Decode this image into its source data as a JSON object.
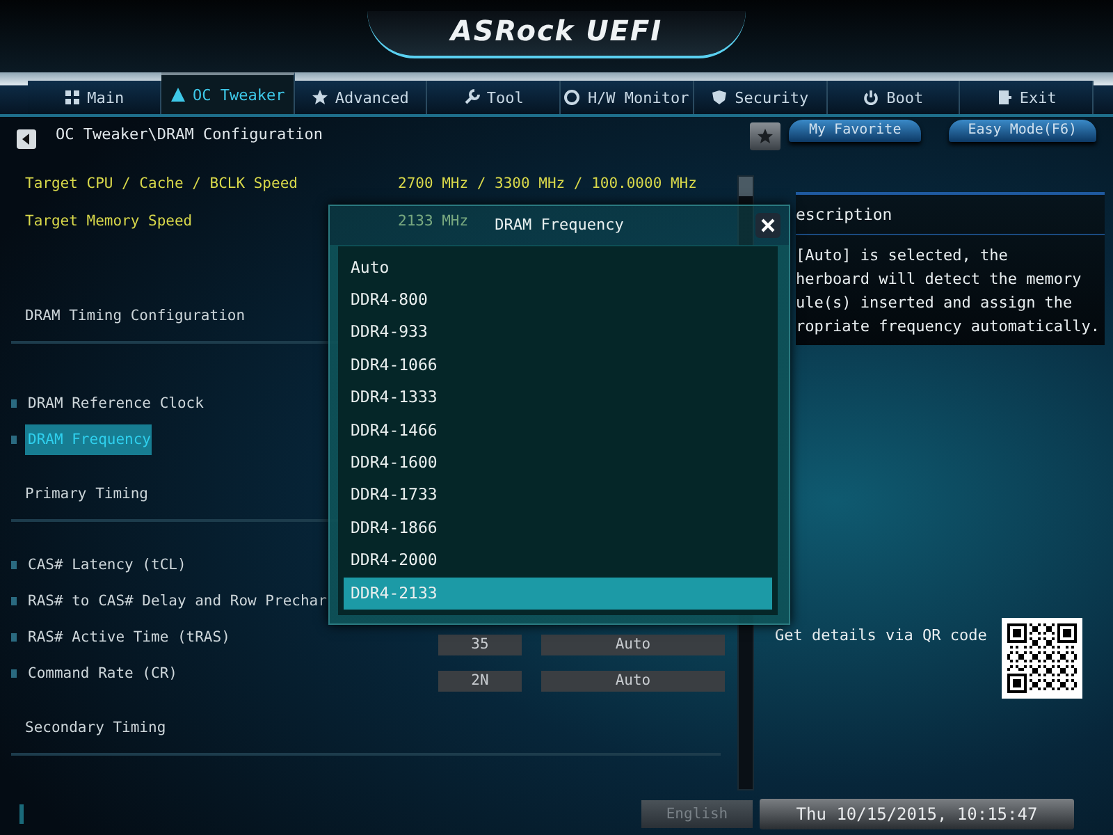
{
  "header": {
    "logo": "ASRock UEFI"
  },
  "tabs": [
    {
      "label": "Main",
      "selected": false
    },
    {
      "label": "OC Tweaker",
      "selected": true
    },
    {
      "label": "Advanced",
      "selected": false
    },
    {
      "label": "Tool",
      "selected": false
    },
    {
      "label": "H/W Monitor",
      "selected": false
    },
    {
      "label": "Security",
      "selected": false
    },
    {
      "label": "Boot",
      "selected": false
    },
    {
      "label": "Exit",
      "selected": false
    }
  ],
  "breadcrumb": {
    "path": "OC Tweaker\\DRAM Configuration"
  },
  "favorite_button": {
    "label": "My Favorite"
  },
  "easy_mode_button": {
    "label": "Easy Mode(F6)"
  },
  "settings": [
    {
      "kind": "info",
      "label": "Target CPU / Cache / BCLK Speed",
      "value": "2700 MHz / 3300 MHz / 100.0000 MHz"
    },
    {
      "kind": "info",
      "label": "Target Memory Speed",
      "value": "2133 MHz"
    },
    {
      "kind": "section",
      "label": "DRAM Timing Configuration"
    },
    {
      "kind": "setting",
      "label": "DRAM Reference Clock",
      "selected": false
    },
    {
      "kind": "setting",
      "label": "DRAM Frequency",
      "selected": true
    },
    {
      "kind": "section",
      "label": "Primary Timing"
    },
    {
      "kind": "setting",
      "label": "CAS# Latency (tCL)",
      "selected": false
    },
    {
      "kind": "setting",
      "label": "RAS# to CAS# Delay and Row Prechar",
      "selected": false
    },
    {
      "kind": "setting",
      "label": "RAS# Active Time (tRAS)",
      "selected": false,
      "value": "35",
      "option": "Auto"
    },
    {
      "kind": "setting",
      "label": "Command Rate (CR)",
      "selected": false,
      "value": "2N",
      "option": "Auto"
    },
    {
      "kind": "section",
      "label": "Secondary Timing"
    }
  ],
  "dialog": {
    "title": "DRAM Frequency",
    "options": [
      {
        "label": "Auto",
        "selected": false
      },
      {
        "label": "DDR4-800",
        "selected": false
      },
      {
        "label": "DDR4-933",
        "selected": false
      },
      {
        "label": "DDR4-1066",
        "selected": false
      },
      {
        "label": "DDR4-1333",
        "selected": false
      },
      {
        "label": "DDR4-1466",
        "selected": false
      },
      {
        "label": "DDR4-1600",
        "selected": false
      },
      {
        "label": "DDR4-1733",
        "selected": false
      },
      {
        "label": "DDR4-1866",
        "selected": false
      },
      {
        "label": "DDR4-2000",
        "selected": false
      },
      {
        "label": "DDR4-2133",
        "selected": true
      }
    ]
  },
  "description": {
    "title": "escription",
    "lines": [
      "[Auto] is selected, the",
      "herboard will detect the memory",
      "ule(s) inserted and assign the",
      "ropriate frequency automatically."
    ]
  },
  "qr": {
    "caption": "Get details via QR code"
  },
  "status_bar": {
    "language": "English",
    "datetime": "Thu 10/15/2015, 10:15:47"
  }
}
